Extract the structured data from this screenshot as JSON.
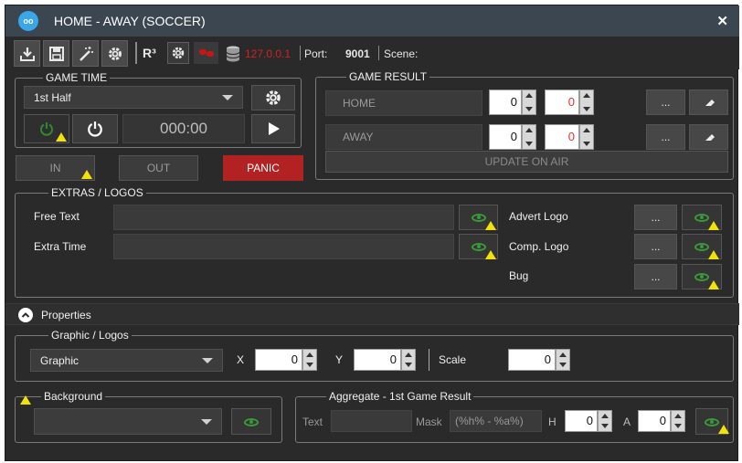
{
  "window": {
    "title": "HOME - AWAY (SOCCER)",
    "app_icon": "oo",
    "close_label": "✕"
  },
  "toolbar": {
    "r3_label": "R³",
    "ip_address": "127.0.0.1",
    "port_label": "Port:",
    "port_value": "9001",
    "scene_label": "Scene:",
    "scene_value": "",
    "icons": [
      "download-icon",
      "save-icon",
      "magic-wand-icon",
      "gear-icon",
      "r3-logo",
      "gear-icon",
      "unlink-icon",
      "database-icon"
    ],
    "colors": {
      "ip_address": "#d42020",
      "unlink_icon": "#c91515"
    }
  },
  "game_time": {
    "legend": "GAME TIME",
    "period_value": "1st Half",
    "clock_value": "000:00",
    "in_label": "IN",
    "out_label": "OUT",
    "panic_label": "PANIC",
    "colors": {
      "panic": "#b32222"
    }
  },
  "game_result": {
    "legend": "GAME RESULT",
    "home_label": "HOME",
    "home_score": "0",
    "home_extra": "0",
    "away_label": "AWAY",
    "away_score": "0",
    "away_extra": "0",
    "browse_label": "...",
    "update_label": "UPDATE ON AIR"
  },
  "extras": {
    "legend": "EXTRAS / LOGOS",
    "free_text_label": "Free Text",
    "free_text_value": "",
    "extra_time_label": "Extra Time",
    "extra_time_value": "",
    "advert_logo_label": "Advert Logo",
    "comp_logo_label": "Comp. Logo",
    "bug_label": "Bug",
    "browse_label": "..."
  },
  "properties": {
    "label": "Properties",
    "icon": "chevron-up-icon"
  },
  "graphic_logos": {
    "legend": "Graphic / Logos",
    "graphic_value": "Graphic",
    "x_label": "X",
    "x_value": "0",
    "y_label": "Y",
    "y_value": "0",
    "scale_label": "Scale",
    "scale_value": "0"
  },
  "background": {
    "legend": "Background",
    "value": ""
  },
  "aggregate": {
    "legend": "Aggregate - 1st Game Result",
    "text_label": "Text",
    "text_value": "",
    "mask_label": "Mask",
    "mask_value": "(%h% - %a%)",
    "h_label": "H",
    "h_value": "0",
    "a_label": "A",
    "a_value": "0"
  },
  "colors": {
    "titlebar": "#3b4650",
    "background": "#2a2a2a",
    "warning": "#f2e20a",
    "eye": "#3a9a3a"
  }
}
